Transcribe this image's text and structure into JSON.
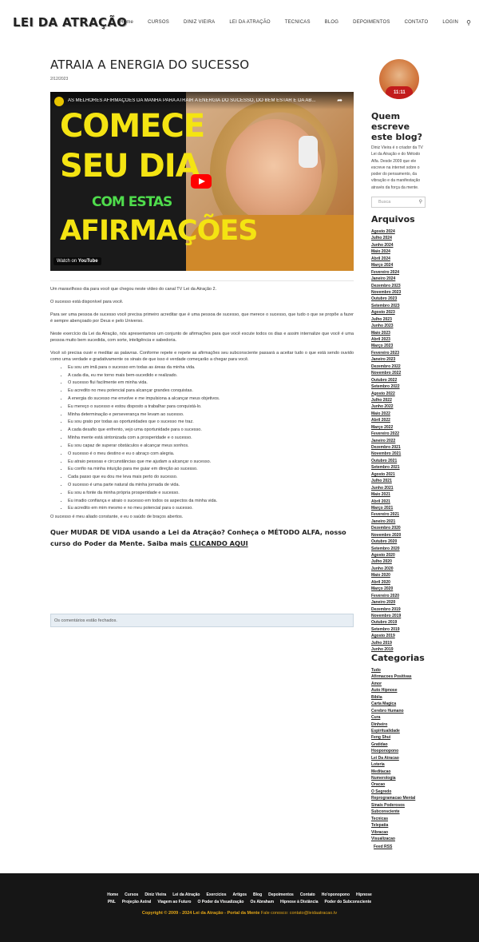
{
  "header": {
    "logo": "LEI DA ATRAÇÃO",
    "nav": [
      "Home",
      "CURSOS",
      "DINIZ VIEIRA",
      "LEI DA ATRAÇÃO",
      "TECNICAS",
      "BLOG",
      "DEPOIMENTOS",
      "CONTATO",
      "LOGIN"
    ],
    "search_icon": "search-icon"
  },
  "post": {
    "title": "ATRAIA A ENERGIA DO SUCESSO",
    "date": "2/12/2023",
    "video": {
      "title": "AS MELHORES AFIRMAÇÕES DA MANHÃ PARA ATRAIR A ENERGIA DO SUCESSO, DO BEM ESTAR E DA AB...",
      "thumb_line1": "COMECE",
      "thumb_line2": "SEU DIA",
      "thumb_line3": "COM ESTAS",
      "thumb_line4": "AFIRMAÇÕES",
      "watch_on": "Watch on",
      "youtube": "YouTube"
    },
    "paragraphs": [
      "Um maravilhoso dia para você que chegou neste vídeo do canal TV Lei da Atração 2.",
      "O sucesso está disponível para você.",
      "Para ser uma pessoa de sucesso você precisa primeiro acreditar que é uma pessoa de sucesso, que merece o sucesso, que tudo o que se propõe a fazer é sempre abençoado por Deus e pelo Universo.",
      "Neste exercício da Lei da Atração, nós apresentamos um conjunto de afirmações para que você escute todos os dias e assim internalize que você é uma pessoa muito bem sucedida, com sorte, inteligência e sabedoria.",
      "Você só precisa ouvir e meditar as palavras. Conforme repete e repete as afirmações seu subconsciente passará a aceitar tudo o que está sendo ouvido como uma verdade e gradativamente os sinais de que isso é verdade começarão a chegar para você."
    ],
    "affirmations": [
      "Eu sou um imã para o sucesso em todas as áreas da minha vida.",
      "A cada dia, eu me torno mais bem-sucedido e realizado.",
      "O sucesso flui facilmente em minha vida.",
      "Eu acredito no meu potencial para alcançar grandes conquistas.",
      "A energia do sucesso me envolve e me impulsiona a alcançar meus objetivos.",
      "Eu mereço o sucesso e estou disposto a trabalhar para conquistá-lo.",
      "Minha determinação e perseverança me levam ao sucesso.",
      "Eu sou grato por todas as oportunidades que o sucesso me traz.",
      "A cada desafio que enfrento, vejo uma oportunidade para o sucesso.",
      "Minha mente está sintonizada com a prosperidade e o sucesso.",
      "Eu sou capaz de superar obstáculos e alcançar meus sonhos.",
      "O sucesso é o meu destino e eu o abraço com alegria.",
      "Eu atraio pessoas e circunstâncias que me ajudam a alcançar o sucesso.",
      "Eu confio na minha intuição para me guiar em direção ao sucesso.",
      "Cada passo que eu dou me leva mais perto do sucesso.",
      "O sucesso é uma parte natural da minha jornada de vida.",
      "Eu sou a fonte da minha própria prosperidade e sucesso.",
      "Eu irradio confiança e atraio o sucesso em todos os aspectos da minha vida.",
      "Eu acredito em mim mesmo e no meu potencial para o sucesso."
    ],
    "closing": "O sucesso é meu aliado constante, e eu o saúdo de braços abertos.",
    "cta_text": "Quer MUDAR DE VIDA usando a Lei da Atração? Conheça o MÉTODO ALFA, nosso curso do Poder da Mente. Saiba mais ",
    "cta_link": "CLICANDO AQUI",
    "comments_closed": "Os comentários estão fechados."
  },
  "sidebar": {
    "avatar_badge": "11:11",
    "who_title": "Quem escreve este blog?",
    "who_text": "Diniz Vieira é o criador da TV Lei da Atração e do Método Alfa. Desde 2009 que ele escreve na internet sobre o poder do pensamento, da vibração e da manifestação através da força da mente.",
    "search_placeholder": "Busca",
    "archives_title": "Arquivos",
    "archives": [
      "Agosto 2024",
      "Julho 2024",
      "Junho 2024",
      "Maio 2024",
      "Abril 2024",
      "Março 2024",
      "Fevereiro 2024",
      "Janeiro 2024",
      "Dezembro 2023",
      "Novembro 2023",
      "Outubro 2023",
      "Setembro 2023",
      "Agosto 2023",
      "Julho 2023",
      "Junho 2023",
      "Maio 2023",
      "Abril 2023",
      "Março 2023",
      "Fevereiro 2023",
      "Janeiro 2023",
      "Dezembro 2022",
      "Novembro 2022",
      "Outubro 2022",
      "Setembro 2022",
      "Agosto 2022",
      "Julho 2022",
      "Junho 2022",
      "Maio 2022",
      "Abril 2022",
      "Março 2022",
      "Fevereiro 2022",
      "Janeiro 2022",
      "Dezembro 2021",
      "Novembro 2021",
      "Outubro 2021",
      "Setembro 2021",
      "Agosto 2021",
      "Julho 2021",
      "Junho 2021",
      "Maio 2021",
      "Abril 2021",
      "Março 2021",
      "Fevereiro 2021",
      "Janeiro 2021",
      "Dezembro 2020",
      "Novembro 2020",
      "Outubro 2020",
      "Setembro 2020",
      "Agosto 2020",
      "Julho 2020",
      "Junho 2020",
      "Maio 2020",
      "Abril 2020",
      "Março 2020",
      "Fevereiro 2020",
      "Janeiro 2020",
      "Dezembro 2019",
      "Novembro 2019",
      "Outubro 2019",
      "Setembro 2019",
      "Agosto 2019",
      "Julho 2019",
      "Junho 2019"
    ],
    "categories_title": "Categorias",
    "categories": [
      "Tudo",
      "Afirmacoes Positivas",
      "Amor",
      "Auto Hipnose",
      "Bíblia",
      "Carta Magica",
      "Cerebro Humano",
      "Cura",
      "Dinheiro",
      "Espiritualidade",
      "Feng Shui",
      "Gratidao",
      "Hooponopono",
      "Lei Da Atracao",
      "Loteria",
      "Meditacao",
      "Numerologia",
      "Oracao",
      "O Segredo",
      "Reprogramacao Mental",
      "Sinais Poderosos",
      "Subconsciente",
      "Tecnicas",
      "Telepatia",
      "Vibracao",
      "Visualizacao"
    ],
    "feed": "Feed RSS"
  },
  "footer": {
    "nav_row1": [
      "Home",
      "Cursos",
      "Diniz Vieira",
      "Lei da Atração",
      "Exercícios",
      "Artigos",
      "Blog",
      "Depoimentos",
      "Contato",
      "Ho'oponopono",
      "Hipnose"
    ],
    "nav_row2": [
      "PNL",
      "Projeção Astral",
      "Viagem ao Futuro",
      "O Poder da Visualização",
      "Os Abraham",
      "Hipnose à Distância",
      "Poder do Subconsciente"
    ],
    "copyright": "Copyright © 2009 - 2024 Lei da Atração - Portal da Mente",
    "contact": " Fale conosco: contato@leidaatracao.tv"
  },
  "colors": {
    "footer_bg": "#161616",
    "copyright": "#e6a817",
    "thumb_yellow": "#f4e412",
    "thumb_green": "#4fdc4c",
    "youtube_red": "#ff0000"
  }
}
